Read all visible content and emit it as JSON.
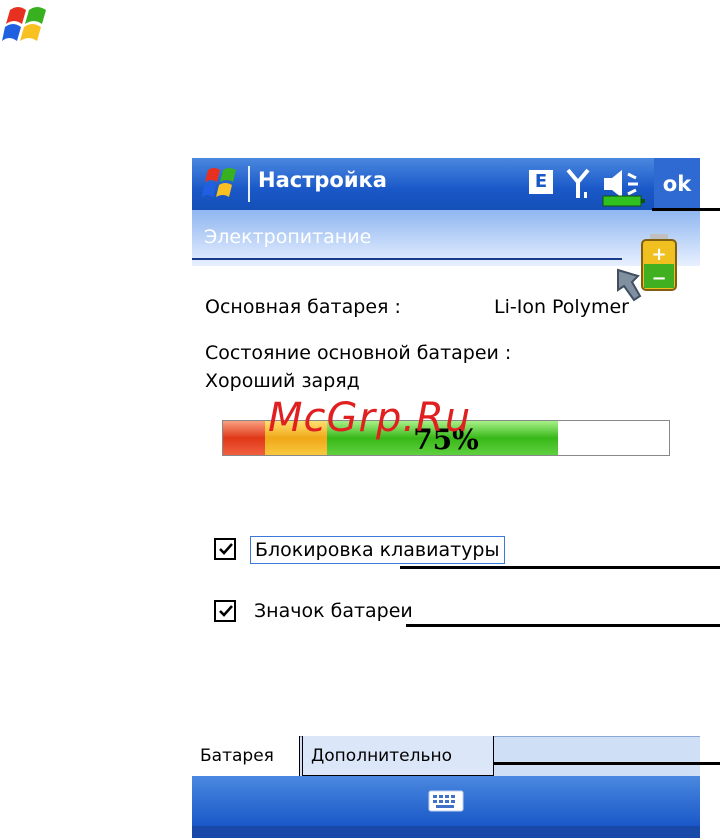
{
  "titlebar": {
    "title": "Настройка",
    "e_indicator": "E",
    "ok_label": "ok"
  },
  "header": {
    "section_title": "Электропитание"
  },
  "battery": {
    "main_label": "Основная батарея :",
    "main_type": "Li-Ion Polymer",
    "state_label": "Состояние основной батареи :",
    "state_value": "Хороший заряд",
    "charge_text": "75%",
    "charge_fraction": 0.75
  },
  "options": {
    "keyboard_lock": {
      "label": "Блокировка клавиатуры",
      "checked": true
    },
    "battery_icon": {
      "label": "Значок батареи",
      "checked": true
    }
  },
  "tabs": [
    {
      "label": "Батарея",
      "active": true
    },
    {
      "label": "Дополнительно",
      "active": false
    }
  ],
  "watermark": "McGrp.Ru",
  "colors": {
    "titlebar": "#1a58c8",
    "accent": "#3c78d8",
    "watermark": "#e02020"
  }
}
